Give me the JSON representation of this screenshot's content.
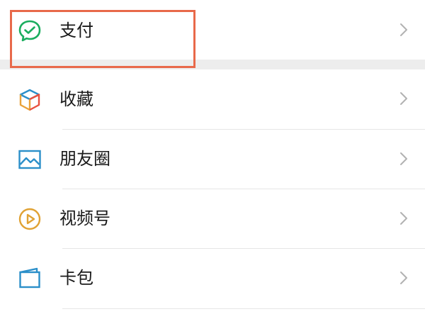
{
  "menu": {
    "items": [
      {
        "label": "支付",
        "icon": "pay-check-icon",
        "color": "#1aad5e"
      },
      {
        "label": "收藏",
        "icon": "favorites-cube-icon",
        "color": "#e9a23b"
      },
      {
        "label": "朋友圈",
        "icon": "moments-image-icon",
        "color": "#2b8fc9"
      },
      {
        "label": "视频号",
        "icon": "channels-play-icon",
        "color": "#e0a234"
      },
      {
        "label": "卡包",
        "icon": "cards-wallet-icon",
        "color": "#2b8fc9"
      }
    ]
  },
  "highlight": {
    "target": "支付",
    "color": "#e8694a"
  }
}
